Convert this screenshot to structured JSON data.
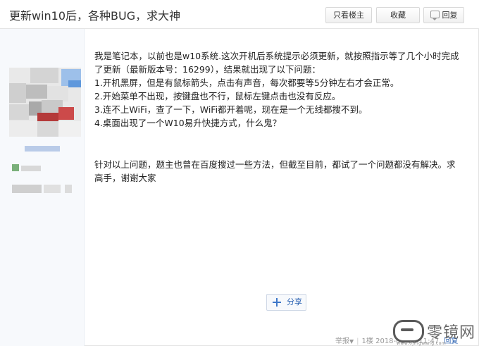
{
  "header": {
    "title": "更新win10后，各种BUG，求大神",
    "only_op_label": "只看楼主",
    "favorite_label": "收藏",
    "reply_label": "回复"
  },
  "post": {
    "paragraphs": [
      "我是笔记本，以前也是w10系统.这次开机后系统提示必须更新，就按照指示等了几个小时完成了更新（最新版本号：16299），结果就出现了以下问题：",
      "1.开机黑屏，但是有鼠标箭头，点击有声音，每次都要等5分钟左右才会正常。",
      "2.开始菜单不出现，按键盘也不行，鼠标左键点击也没有反应。",
      "3.连不上WiFi，查了一下，WiFi都开着呢，现在是一个无线都搜不到。",
      "4.桌面出现了一个W10易升快捷方式，什么鬼？"
    ],
    "paragraph2": "针对以上问题，题主也曾在百度搜过一些方法，但截至目前，都试了一个问题都没有解决。求高手，谢谢大家",
    "share_label": "分享"
  },
  "footer": {
    "report_label": "举报",
    "floor": "1楼",
    "datetime": "2018-01-06 11:47",
    "reply_link": "回复"
  },
  "watermark": {
    "brand": "零镜网",
    "url": "www.0jingwang.com"
  }
}
